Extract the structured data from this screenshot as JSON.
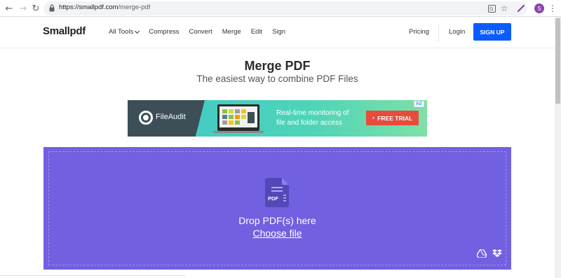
{
  "browser": {
    "url_host": "https://smallpdf.com",
    "url_path": "/merge-pdf",
    "profile_initial": "S",
    "nav_glyphs": {
      "back": "←",
      "forward": "→",
      "reload": "↻",
      "star": "☆",
      "menu": "⋮"
    }
  },
  "header": {
    "logo": "Smallpdf",
    "nav": [
      {
        "label": "All Tools"
      },
      {
        "label": "Compress"
      },
      {
        "label": "Convert"
      },
      {
        "label": "Merge"
      },
      {
        "label": "Edit"
      },
      {
        "label": "Sign"
      }
    ],
    "pricing": "Pricing",
    "login": "Login",
    "signup": "SIGN UP"
  },
  "hero": {
    "title": "Merge PDF",
    "subtitle": "The easiest way to combine PDF Files"
  },
  "ad": {
    "brand": "FileAudit",
    "line1": "Real-time monitoring of",
    "line2": "file and folder access",
    "cta": "FREE TRIAL",
    "tag": "Ad"
  },
  "dropzone": {
    "icon_label": "PDF",
    "drop_text": "Drop PDF(s) here",
    "choose_text": "Choose file"
  },
  "colors": {
    "accent": "#0b5cff",
    "dropzone": "#7161e0",
    "ad_cta": "#e64c3c"
  }
}
